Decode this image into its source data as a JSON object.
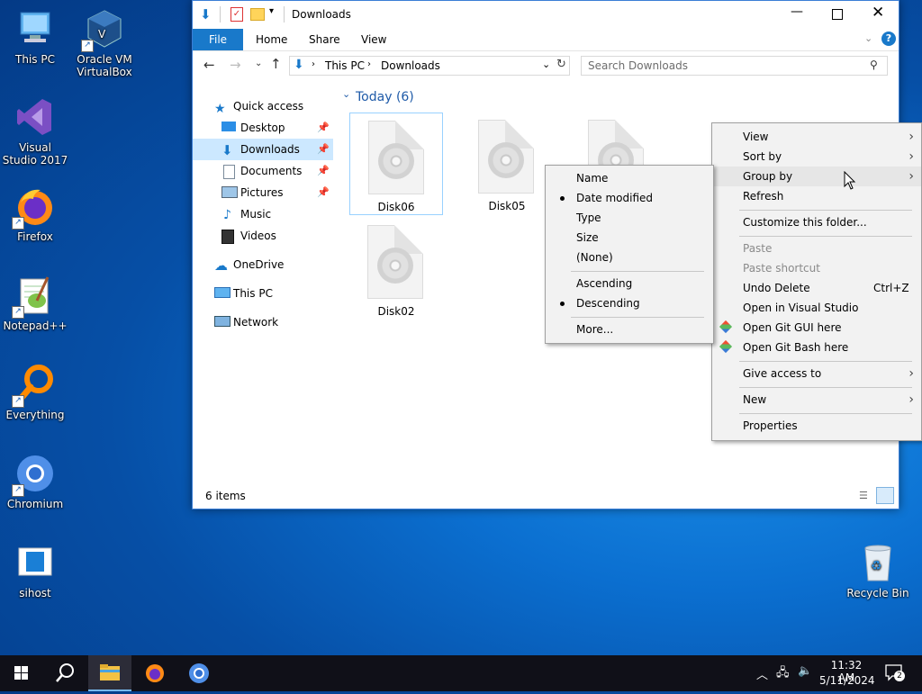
{
  "desktop": {
    "icons": [
      {
        "label": "This PC"
      },
      {
        "label": "Oracle VM VirtualBox"
      },
      {
        "label": "Visual Studio 2017"
      },
      {
        "label": "Firefox"
      },
      {
        "label": "Notepad++"
      },
      {
        "label": "Everything"
      },
      {
        "label": "Chromium"
      },
      {
        "label": "sihost"
      },
      {
        "label": "Recycle Bin"
      }
    ]
  },
  "window": {
    "title": "Downloads",
    "ribbon_tabs": [
      "File",
      "Home",
      "Share",
      "View"
    ],
    "address": {
      "parts": [
        "This PC",
        "Downloads"
      ]
    },
    "search_placeholder": "Search Downloads",
    "nav": {
      "items": [
        {
          "label": "Quick access"
        },
        {
          "label": "Desktop"
        },
        {
          "label": "Downloads"
        },
        {
          "label": "Documents"
        },
        {
          "label": "Pictures"
        },
        {
          "label": "Music"
        },
        {
          "label": "Videos"
        },
        {
          "label": "OneDrive"
        },
        {
          "label": "This PC"
        },
        {
          "label": "Network"
        }
      ]
    },
    "group_header": "Today (6)",
    "files": [
      "Disk06",
      "Disk05",
      "Disk02"
    ],
    "status": "6 items"
  },
  "context_menu": {
    "items": [
      {
        "label": "View"
      },
      {
        "label": "Sort by"
      },
      {
        "label": "Group by"
      },
      {
        "label": "Refresh"
      },
      {
        "label": "Customize this folder..."
      },
      {
        "label": "Paste"
      },
      {
        "label": "Paste shortcut"
      },
      {
        "label": "Undo Delete",
        "shortcut": "Ctrl+Z"
      },
      {
        "label": "Open in Visual Studio"
      },
      {
        "label": "Open Git GUI here"
      },
      {
        "label": "Open Git Bash here"
      },
      {
        "label": "Give access to"
      },
      {
        "label": "New"
      },
      {
        "label": "Properties"
      }
    ]
  },
  "submenu": {
    "items": [
      {
        "label": "Name"
      },
      {
        "label": "Date modified"
      },
      {
        "label": "Type"
      },
      {
        "label": "Size"
      },
      {
        "label": "(None)"
      },
      {
        "label": "Ascending"
      },
      {
        "label": "Descending"
      },
      {
        "label": "More..."
      }
    ]
  },
  "taskbar": {
    "time": "11:32 AM",
    "date": "5/11/2024",
    "notifications": "2"
  }
}
